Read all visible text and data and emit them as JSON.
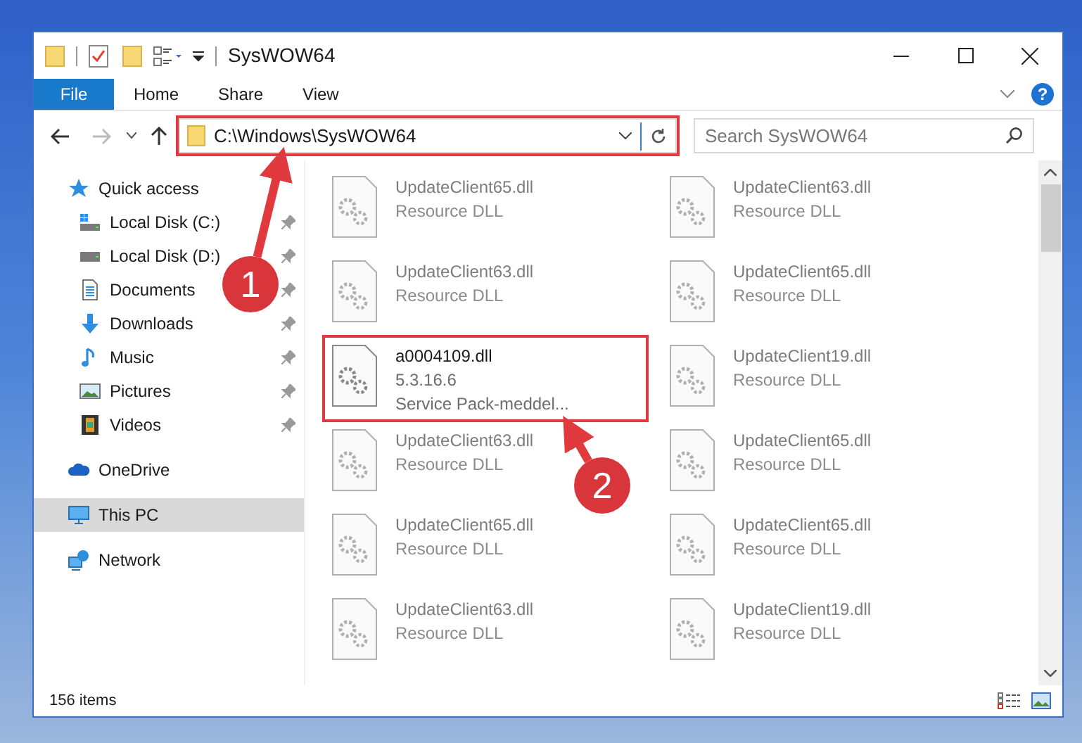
{
  "window": {
    "title": "SysWOW64"
  },
  "ribbon_tabs": [
    {
      "label": "File",
      "kind": "menu",
      "selected": false
    },
    {
      "label": "Home",
      "kind": "tab",
      "selected": false
    },
    {
      "label": "Share",
      "kind": "tab",
      "selected": false
    },
    {
      "label": "View",
      "kind": "tab",
      "selected": false
    }
  ],
  "help_button": {
    "label": "?"
  },
  "address_bar": {
    "path": "C:\\Windows\\SysWOW64",
    "highlighted": true
  },
  "search": {
    "placeholder": "Search SysWOW64"
  },
  "sidebar": {
    "items": [
      {
        "label": "Quick access",
        "kind": "star",
        "selected": false,
        "pinned": false,
        "children": [
          {
            "label": "Local Disk (C:)",
            "kind": "system-drive",
            "selected": false,
            "pinned": true
          },
          {
            "label": "Local Disk (D:)",
            "kind": "drive",
            "selected": false,
            "pinned": true
          },
          {
            "label": "Documents",
            "kind": "document",
            "selected": false,
            "pinned": true
          },
          {
            "label": "Downloads",
            "kind": "download",
            "selected": false,
            "pinned": true
          },
          {
            "label": "Music",
            "kind": "music",
            "selected": false,
            "pinned": true
          },
          {
            "label": "Pictures",
            "kind": "picture",
            "selected": false,
            "pinned": true
          },
          {
            "label": "Videos",
            "kind": "video",
            "selected": false,
            "pinned": true
          }
        ]
      },
      {
        "label": "OneDrive",
        "kind": "cloud",
        "selected": false,
        "pinned": false
      },
      {
        "label": "This PC",
        "kind": "computer",
        "selected": true,
        "pinned": false
      },
      {
        "label": "Network",
        "kind": "network",
        "selected": false,
        "pinned": false
      }
    ]
  },
  "files": [
    {
      "name": "UpdateClient65.dll",
      "details": [
        "Resource DLL"
      ],
      "blurred": true,
      "highlighted": false
    },
    {
      "name": "UpdateClient63.dll",
      "details": [
        "Resource DLL"
      ],
      "blurred": true,
      "highlighted": false
    },
    {
      "name": "UpdateClient63.dll",
      "details": [
        "Resource DLL"
      ],
      "blurred": true,
      "highlighted": false
    },
    {
      "name": "UpdateClient65.dll",
      "details": [
        "Resource DLL"
      ],
      "blurred": true,
      "highlighted": false
    },
    {
      "name": "a0004109.dll",
      "details": [
        "5.3.16.6",
        "Service Pack-meddel..."
      ],
      "blurred": false,
      "highlighted": true
    },
    {
      "name": "UpdateClient19.dll",
      "details": [
        "Resource DLL"
      ],
      "blurred": true,
      "highlighted": false
    },
    {
      "name": "UpdateClient63.dll",
      "details": [
        "Resource DLL"
      ],
      "blurred": true,
      "highlighted": false
    },
    {
      "name": "UpdateClient65.dll",
      "details": [
        "Resource DLL"
      ],
      "blurred": true,
      "highlighted": false
    },
    {
      "name": "UpdateClient65.dll",
      "details": [
        "Resource DLL"
      ],
      "blurred": true,
      "highlighted": false
    },
    {
      "name": "UpdateClient65.dll",
      "details": [
        "Resource DLL"
      ],
      "blurred": true,
      "highlighted": false
    },
    {
      "name": "UpdateClient63.dll",
      "details": [
        "Resource DLL"
      ],
      "blurred": true,
      "highlighted": false
    },
    {
      "name": "UpdateClient19.dll",
      "details": [
        "Resource DLL"
      ],
      "blurred": true,
      "highlighted": false
    }
  ],
  "status_bar": {
    "item_count": "156 items"
  },
  "annotations": [
    {
      "label": "1"
    },
    {
      "label": "2"
    }
  ]
}
